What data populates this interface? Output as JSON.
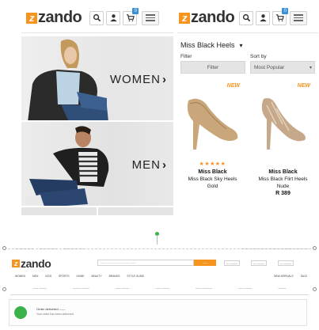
{
  "brand": {
    "logo_letter": "z",
    "logo_text": "zando",
    "accent": "#f7941d",
    "badge_color": "#3a8fd6"
  },
  "mobile_home": {
    "cart_count": "0",
    "banners": [
      {
        "label": "WOMEN",
        "chevron": "›"
      },
      {
        "label": "MEN",
        "chevron": "›"
      }
    ]
  },
  "mobile_listing": {
    "cart_count": "0",
    "category": "Miss Black Heels",
    "filter": {
      "label": "Filter",
      "button": "Filter"
    },
    "sort": {
      "label": "Sort by",
      "value": "Most Popular"
    },
    "products": [
      {
        "tag": "NEW",
        "stars": "★★★★★",
        "brand": "Miss Black",
        "name": "Miss Black Sky Heels",
        "detail": "Gold",
        "color": "#c9a77a"
      },
      {
        "tag": "NEW",
        "stars": "",
        "brand": "Miss Black",
        "name": "Miss Black Flirt Heels",
        "detail": "Nude",
        "price": "R 389",
        "color": "#c5a98a"
      }
    ]
  },
  "desktop": {
    "top_left": [
      "— ——— ——",
      "——— ———",
      "—— ——— ——"
    ],
    "top_right": "——— ——— ———  ————————— ——— ——",
    "logo_letter": "z",
    "logo_text": "zando",
    "search_placeholder": "—— ———— ———— ——",
    "search_button": "——",
    "account_btn": "— ———",
    "wishlist_btn": "— ———",
    "cart_btn": "— ———",
    "nav": [
      "WOMEN",
      "MEN",
      "KIDS",
      "SPORTS",
      "HOME",
      "BEAUTY",
      "BRANDS",
      "STYLE GUIDE"
    ],
    "nav_right": "NEW ARRIVALS",
    "nav_sale": "SALE",
    "tabs": [
      "—— ———",
      "——— ———",
      "—— ———",
      "—— ———",
      "—— ————",
      "—— ———",
      "———"
    ],
    "order_title": "Order delivered ——",
    "order_sub": "Your order has been delivered"
  }
}
